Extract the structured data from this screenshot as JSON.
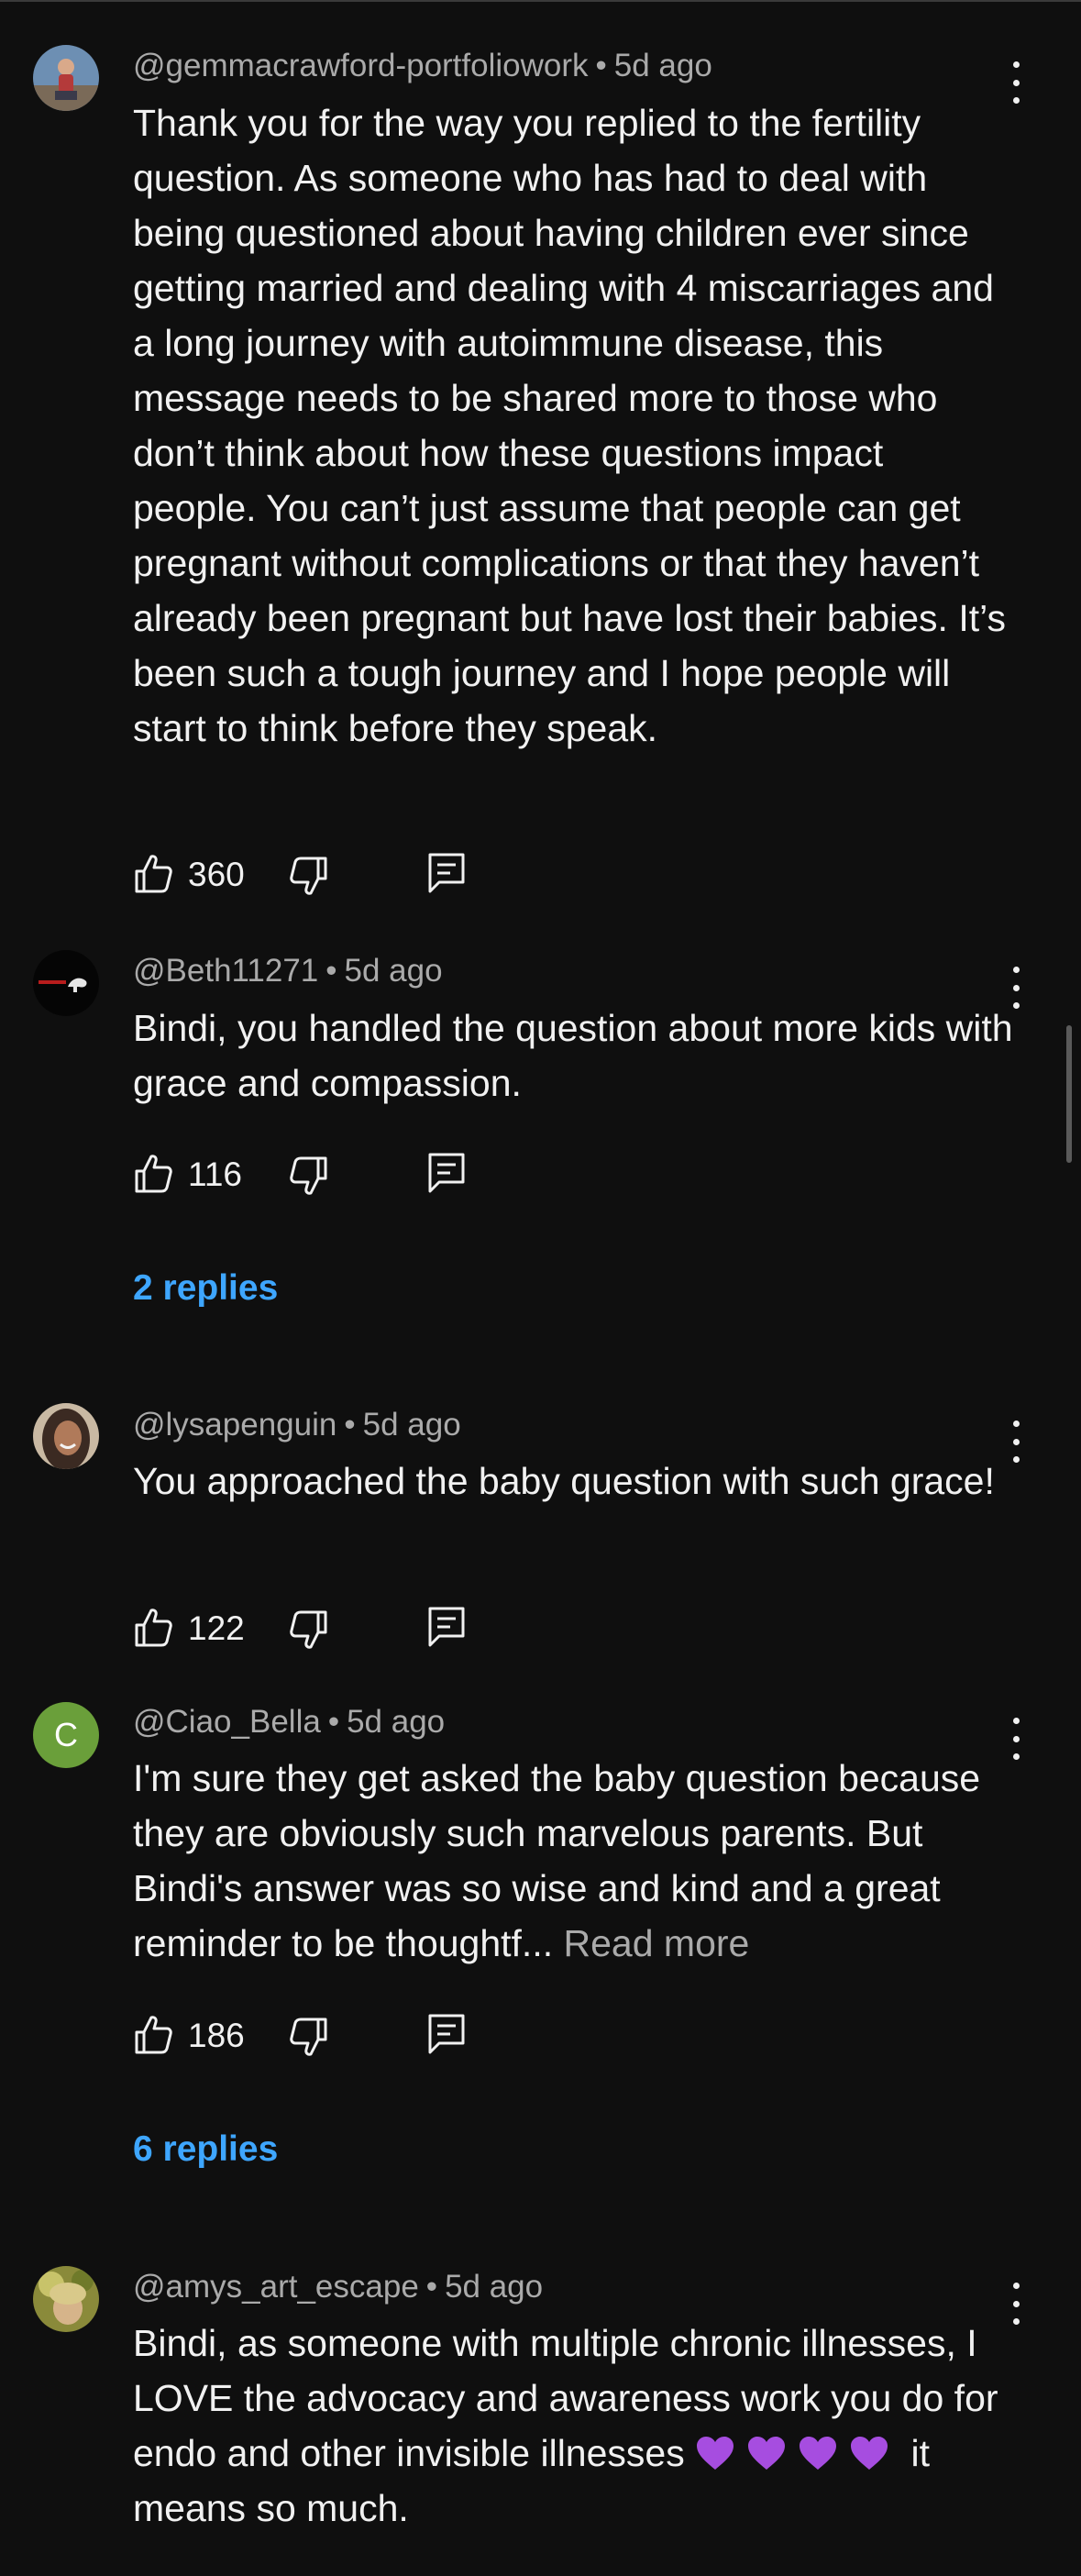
{
  "comments": [
    {
      "handle": "@gemmacrawford-portfoliowork",
      "time": "5d ago",
      "text": "Thank you for the way you replied to the fertility question. As someone who has had to deal with being questioned about having children ever since getting married and dealing with 4 miscarriages and a long journey with autoimmune disease, this message needs to be shared more to those who don’t think about how these questions impact people. You can’t just assume that people can get pregnant without complications or that they haven’t already been pregnant but have lost their babies. It’s been such a tough journey and I hope people will start to think before they speak.",
      "likes": "360"
    },
    {
      "handle": "@Beth11271",
      "time": "5d ago",
      "text": "Bindi, you handled the question about more kids with grace and compassion.",
      "likes": "116",
      "replies": "2 replies"
    },
    {
      "handle": "@lysapenguin",
      "time": "5d ago",
      "text": "You approached the baby question with such grace!",
      "likes": "122"
    },
    {
      "handle": "@Ciao_Bella",
      "time": "5d ago",
      "avatar_letter": "C",
      "avatar_color": "#6a9f3a",
      "text": "I'm sure they get asked the baby question because they are obviously such marvelous parents. But Bindi's answer was so wise and kind and a great reminder to be thoughtf...",
      "read_more": "Read more",
      "likes": "186",
      "replies": "6 replies"
    },
    {
      "handle": "@amys_art_escape",
      "time": "5d ago",
      "text_before": "Bindi, as someone with multiple chronic illnesses, I LOVE the advocacy and awareness work you do for endo and other invisible illnesses",
      "text_after": "it means so much.",
      "emoji": "purple-heart"
    }
  ],
  "colors": {
    "background": "#0f0f0f",
    "text": "#f1f1f1",
    "meta": "#aaaaaa",
    "link": "#3ea6ff"
  },
  "icons": [
    "thumbs-up-icon",
    "thumbs-down-icon",
    "reply-icon",
    "more-vert-icon",
    "purple-heart-icon"
  ]
}
